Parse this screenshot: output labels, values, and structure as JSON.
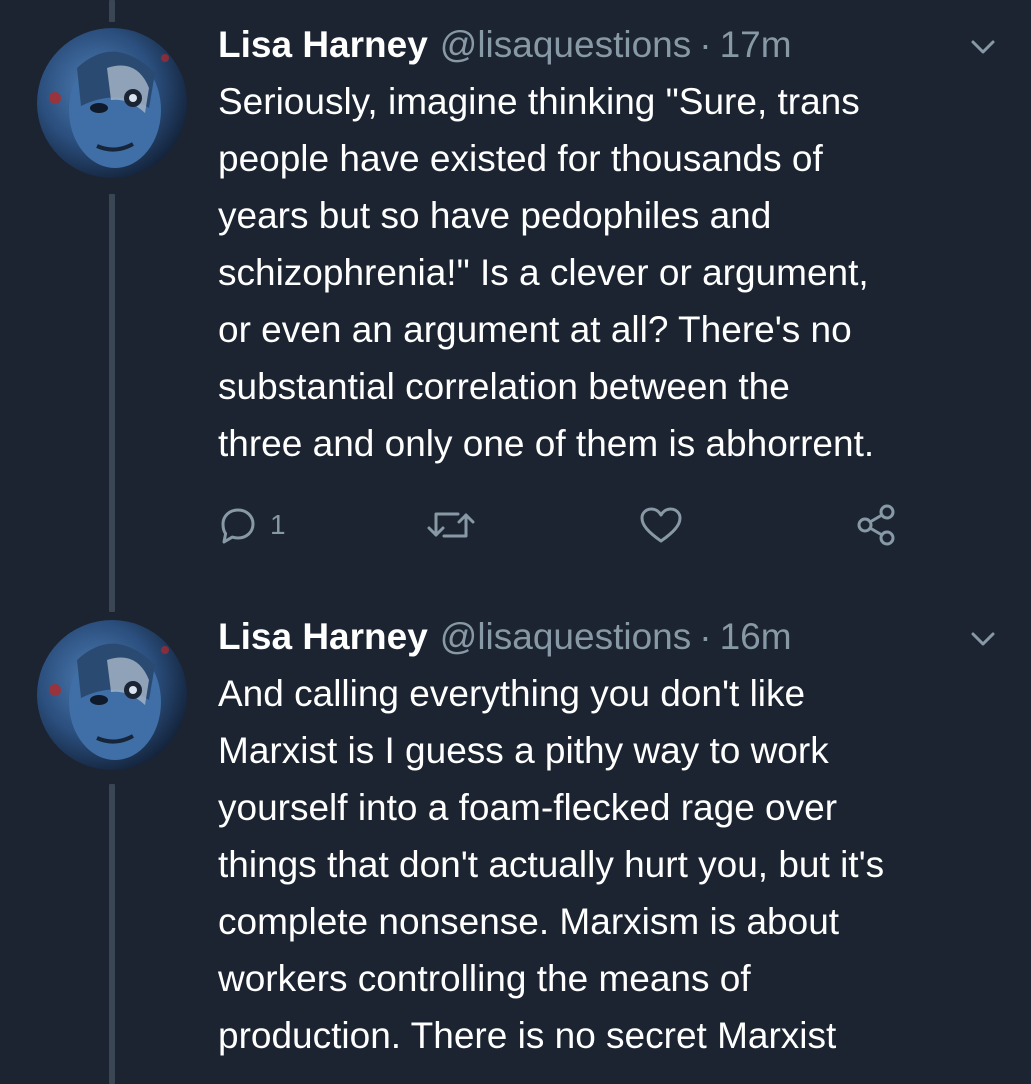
{
  "tweets": [
    {
      "name": "Lisa Harney",
      "handle": "@lisaquestions",
      "separator": "·",
      "time": "17m",
      "lines": [
        "Seriously, imagine thinking \"Sure, trans",
        "people have existed for thousands of",
        "years but so have pedophiles and",
        "schizophrenia!\" Is a clever or argument,",
        "or even an argument at all? There's no",
        "substantial correlation between the",
        "three and only one of them is abhorrent."
      ],
      "reply_count": "1"
    },
    {
      "name": "Lisa Harney",
      "handle": "@lisaquestions",
      "separator": "·",
      "time": "16m",
      "lines": [
        "And calling everything you don't like",
        "Marxist is I guess a pithy way to work",
        "yourself into a foam-flecked rage over",
        "things that don't actually hurt you, but it's",
        "complete nonsense. Marxism is about",
        "workers controlling the means of",
        "production. There is no secret Marxist"
      ]
    }
  ],
  "icons": {
    "reply": "reply-icon",
    "retweet": "retweet-icon",
    "like": "heart-icon",
    "share": "share-icon",
    "menu": "chevron-down-icon"
  },
  "colors": {
    "background": "#1b2430",
    "secondary_text": "#8899a6",
    "thread_line": "#3a4654"
  }
}
